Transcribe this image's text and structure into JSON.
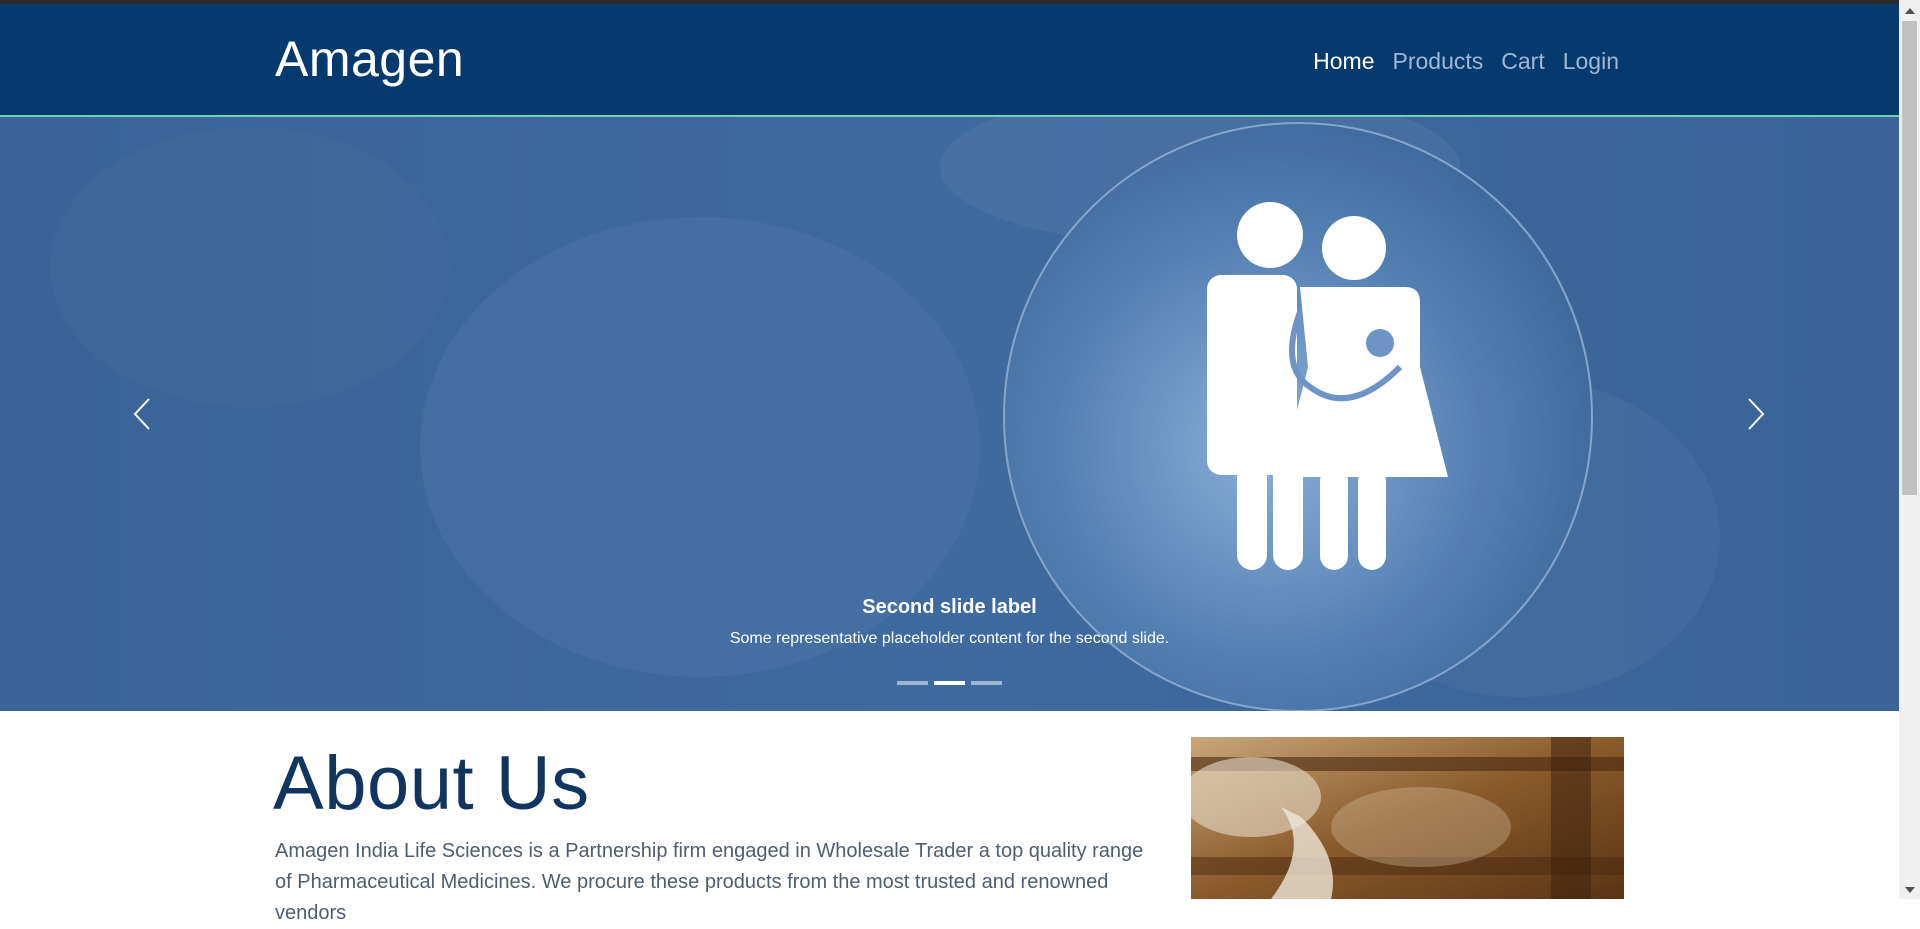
{
  "navbar": {
    "brand": "Amagen",
    "links": [
      {
        "label": "Home",
        "active": true
      },
      {
        "label": "Products",
        "active": false
      },
      {
        "label": "Cart",
        "active": false
      },
      {
        "label": "Login",
        "active": false
      }
    ]
  },
  "carousel": {
    "caption_title": "Second slide label",
    "caption_text": "Some representative placeholder content for the second slide.",
    "indicators": [
      false,
      true,
      false
    ],
    "prev_icon": "chevron-left-icon",
    "next_icon": "chevron-right-icon"
  },
  "about": {
    "title": "About Us",
    "text": "Amagen India Life Sciences is a Partnership firm engaged in Wholesale Trader a top quality range of Pharmaceutical Medicines. We procure these products from the most trusted and renowned vendors"
  },
  "colors": {
    "navbar": "#063a6e",
    "accent_line": "#6fd4b6",
    "hero_overlay": "#3a6599",
    "about_title": "#12355f"
  }
}
